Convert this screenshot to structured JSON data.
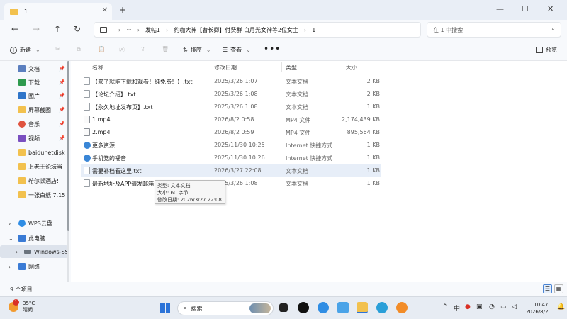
{
  "window": {
    "tab_title": "1",
    "tab_close": "✕",
    "new_tab": "+",
    "controls": [
      "—",
      "☐",
      "✕"
    ]
  },
  "navigation": {
    "back": "←",
    "forward": "→",
    "up": "↑",
    "refresh": "↻",
    "breadcrumb": [
      "发帖1",
      "约啪大神【曹长卿】付费群 白月光女神等2位女主",
      "1"
    ],
    "search_placeholder": "在 1 中搜索"
  },
  "toolbar": {
    "new_label": "新建",
    "sort_label": "排序",
    "view_label": "查看",
    "more_label": "•••",
    "preview_label": "预览"
  },
  "sidebar": {
    "quick": [
      {
        "label": "文档",
        "icon": "document-icon",
        "color": "#5b7fbf"
      },
      {
        "label": "下载",
        "icon": "download-icon",
        "color": "#2e9a4e"
      },
      {
        "label": "图片",
        "icon": "picture-icon",
        "color": "#2f75c9"
      },
      {
        "label": "屏幕截图",
        "icon": "folder-icon",
        "color": "#f2c14e"
      },
      {
        "label": "音乐",
        "icon": "music-icon",
        "color": "#e0533f"
      },
      {
        "label": "视频",
        "icon": "video-icon",
        "color": "#7a4fc0"
      },
      {
        "label": "baidunetdisk",
        "icon": "folder-icon",
        "color": "#f2c14e"
      },
      {
        "label": "上老王论坛当",
        "icon": "folder-icon",
        "color": "#f2c14e"
      },
      {
        "label": "希尔顿酒店!",
        "icon": "folder-icon",
        "color": "#f2c14e"
      },
      {
        "label": "一张白纸 7.15",
        "icon": "folder-icon",
        "color": "#f2c14e"
      }
    ],
    "tree": [
      {
        "label": "WPS云盘",
        "icon": "cloud-icon",
        "color": "#2f8de4",
        "chevron": "›"
      },
      {
        "label": "此电脑",
        "icon": "computer-icon",
        "color": "#3a7bd5",
        "chevron": "⌄"
      },
      {
        "label": "Windows-SSD",
        "icon": "drive-icon",
        "color": "#6a737d",
        "chevron": "›"
      },
      {
        "label": "网络",
        "icon": "network-icon",
        "color": "#3a7bd5",
        "chevron": "›"
      }
    ]
  },
  "table": {
    "headers": {
      "name": "名称",
      "date": "修改日期",
      "type": "类型",
      "size": "大小"
    },
    "rows": [
      {
        "name": "【来了就能下载和观看！纯免费！】.txt",
        "date": "2025/3/26 1:07",
        "type": "文本文档",
        "size": "2 KB",
        "icon": "text-file-icon"
      },
      {
        "name": "【论坛介绍】.txt",
        "date": "2025/3/26 1:08",
        "type": "文本文档",
        "size": "2 KB",
        "icon": "text-file-icon"
      },
      {
        "name": "【永久地址发布页】.txt",
        "date": "2025/3/26 1:08",
        "type": "文本文档",
        "size": "1 KB",
        "icon": "text-file-icon"
      },
      {
        "name": "1.mp4",
        "date": "2026/8/2 0:58",
        "type": "MP4 文件",
        "size": "2,174,439 KB",
        "icon": "video-file-icon"
      },
      {
        "name": "2.mp4",
        "date": "2026/8/2 0:59",
        "type": "MP4 文件",
        "size": "895,564 KB",
        "icon": "video-file-icon"
      },
      {
        "name": "更多资源",
        "date": "2025/11/30 10:25",
        "type": "Internet 快捷方式",
        "size": "1 KB",
        "icon": "internet-shortcut-icon"
      },
      {
        "name": "手机党的福音",
        "date": "2025/11/30 10:26",
        "type": "Internet 快捷方式",
        "size": "1 KB",
        "icon": "internet-shortcut-icon"
      },
      {
        "name": "需要补档看这里.txt",
        "date": "2026/3/27 22:08",
        "type": "文本文档",
        "size": "1 KB",
        "icon": "text-file-icon"
      },
      {
        "name": "最新地址及APP请发邮箱自动获取",
        "date": "2025/3/26 1:08",
        "type": "文本文档",
        "size": "1 KB",
        "icon": "text-file-icon"
      }
    ]
  },
  "tooltip": {
    "line1": "类型: 文本文档",
    "line2": "大小: 60 字节",
    "line3": "修改日期: 2026/3/27 22:08"
  },
  "status": {
    "item_count": "9 个项目"
  },
  "taskbar": {
    "weather_badge": "1",
    "temperature": "35°C",
    "condition": "晴朗",
    "search_label": "搜索",
    "lang": "中",
    "time": "10:47",
    "date": "2026/8/2"
  }
}
